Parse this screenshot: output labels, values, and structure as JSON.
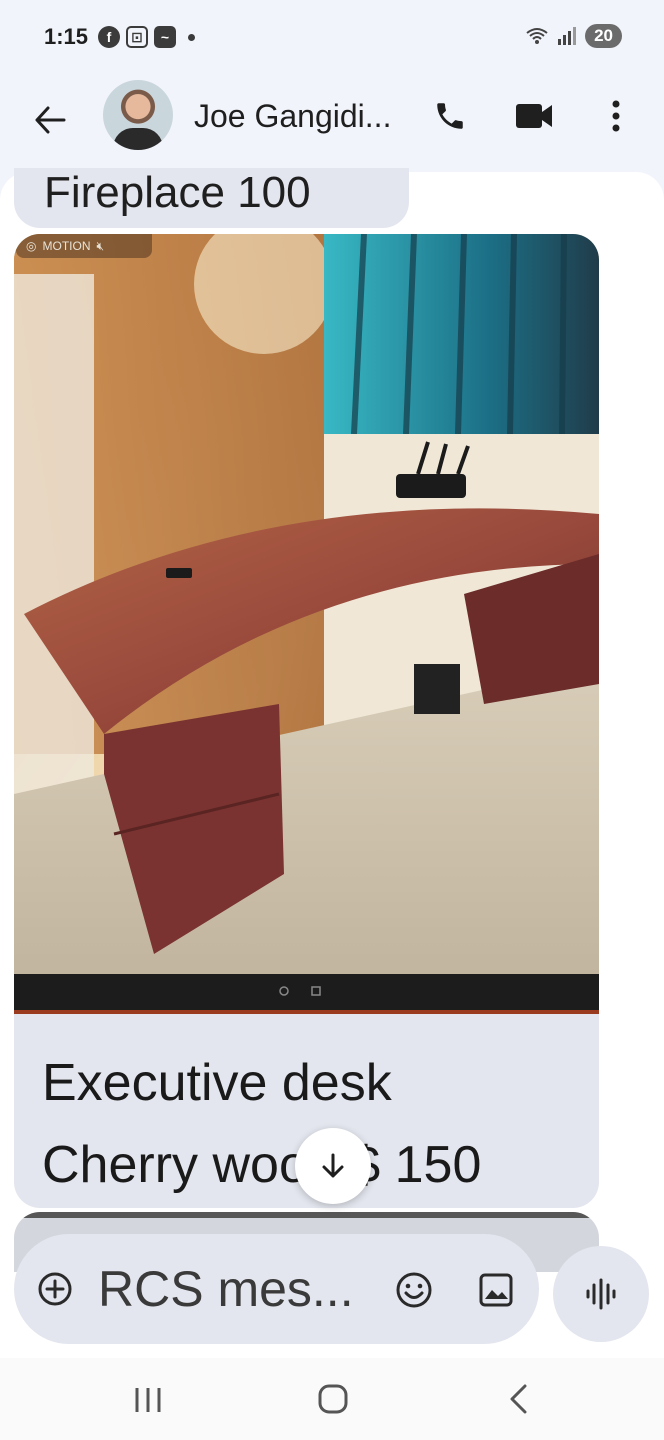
{
  "status_bar": {
    "time": "1:15",
    "battery": "20",
    "notification_icons": [
      "facebook-icon",
      "screenshot-icon",
      "app-icon"
    ],
    "wifi_label": "5"
  },
  "header": {
    "contact_name": "Joe Gangidi...",
    "icons": [
      "back-arrow-icon",
      "phone-icon",
      "video-camera-icon",
      "more-vert-icon"
    ]
  },
  "conversation": {
    "previous_message_text": "Fireplace 100",
    "photo_badge": "MOTION",
    "message_text": "Executive desk\nCherry wood $ 150"
  },
  "compose": {
    "placeholder": "RCS mes..."
  },
  "nav": {
    "icons": [
      "recents-icon",
      "home-icon",
      "back-icon"
    ]
  },
  "colors": {
    "surface": "#f2f4fb",
    "bubble": "#e4e6ef",
    "text": "#1f1f1f"
  }
}
